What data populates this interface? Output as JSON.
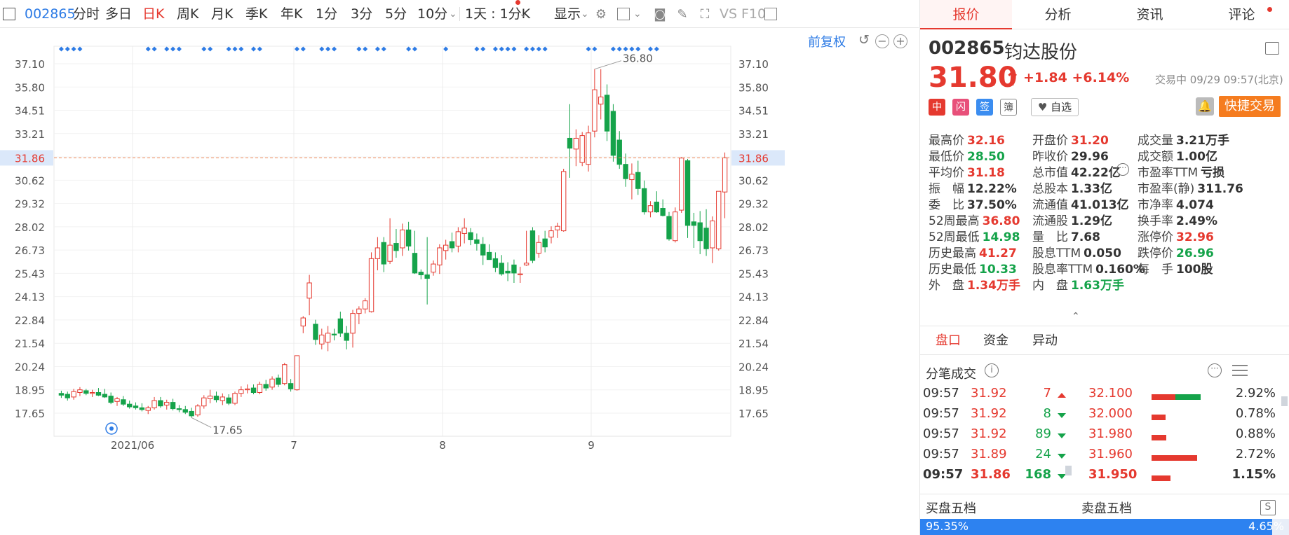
{
  "toolbar": {
    "code": "002865",
    "periods": [
      "分时",
      "多日",
      "日K",
      "周K",
      "月K",
      "季K",
      "年K",
      "1分",
      "3分",
      "5分",
      "10分"
    ],
    "active_period": "日K",
    "range_select": "1天 : 1分K",
    "display_label": "显示",
    "vs_label": "VS",
    "f10_label": "F10"
  },
  "chart": {
    "adjust_label": "前复权",
    "current_line_label": "31.86",
    "high_marker": "36.80",
    "low_marker": "17.65",
    "x_tick_labels": [
      "2021/06",
      "7",
      "8",
      "9"
    ]
  },
  "tabs": [
    "报价",
    "分析",
    "资讯",
    "评论"
  ],
  "quote": {
    "code": "002865",
    "name": "钧达股份",
    "price": "31.80",
    "change": "+1.84",
    "change_pct": "+6.14%",
    "status": "交易中 09/29 09:57(北京)",
    "watchlist_label": "自选",
    "quick_trade_label": "快捷交易",
    "badges": [
      "中",
      "闪",
      "签",
      "簿"
    ]
  },
  "quote_items": [
    {
      "label": "最高价",
      "value": "32.16",
      "color": "red"
    },
    {
      "label": "开盘价",
      "value": "31.20",
      "color": "red"
    },
    {
      "label": "成交量",
      "value": "3.21万手",
      "color": "dark"
    },
    {
      "label": "最低价",
      "value": "28.50",
      "color": "green"
    },
    {
      "label": "昨收价",
      "value": "29.96",
      "color": "dark"
    },
    {
      "label": "成交额",
      "value": "1.00亿",
      "color": "dark"
    },
    {
      "label": "平均价",
      "value": "31.18",
      "color": "red"
    },
    {
      "label": "总市值",
      "value": "42.22亿",
      "color": "dark"
    },
    {
      "label": "市盈率TTM",
      "value": "亏损",
      "color": "dark"
    },
    {
      "label": "振　幅",
      "value": "12.22%",
      "color": "dark"
    },
    {
      "label": "总股本",
      "value": "1.33亿",
      "color": "dark"
    },
    {
      "label": "市盈率(静)",
      "value": "311.76",
      "color": "dark"
    },
    {
      "label": "委　比",
      "value": "37.50%",
      "color": "dark"
    },
    {
      "label": "流通值",
      "value": "41.013亿",
      "color": "dark"
    },
    {
      "label": "市净率",
      "value": "4.074",
      "color": "dark"
    },
    {
      "label": "52周最高",
      "value": "36.80",
      "color": "red"
    },
    {
      "label": "流通股",
      "value": "1.29亿",
      "color": "dark"
    },
    {
      "label": "换手率",
      "value": "2.49%",
      "color": "dark"
    },
    {
      "label": "52周最低",
      "value": "14.98",
      "color": "green"
    },
    {
      "label": "量　比",
      "value": "7.68",
      "color": "dark"
    },
    {
      "label": "涨停价",
      "value": "32.96",
      "color": "red"
    },
    {
      "label": "历史最高",
      "value": "41.27",
      "color": "red"
    },
    {
      "label": "股息TTM",
      "value": "0.050",
      "color": "dark"
    },
    {
      "label": "跌停价",
      "value": "26.96",
      "color": "green"
    },
    {
      "label": "历史最低",
      "value": "10.33",
      "color": "green"
    },
    {
      "label": "股息率TTM",
      "value": "0.160%",
      "color": "dark"
    },
    {
      "label": "每　手",
      "value": "100股",
      "color": "dark"
    },
    {
      "label": "外　盘",
      "value": "1.34万手",
      "color": "red"
    },
    {
      "label": "内　盘",
      "value": "1.63万手",
      "color": "green"
    }
  ],
  "sub_tabs": [
    "盘口",
    "资金",
    "异动"
  ],
  "ticks_title": "分笔成交",
  "ticks": [
    {
      "time": "09:57",
      "price": "31.92",
      "vol": "7",
      "dir": "up"
    },
    {
      "time": "09:57",
      "price": "31.92",
      "vol": "8",
      "dir": "down"
    },
    {
      "time": "09:57",
      "price": "31.92",
      "vol": "89",
      "dir": "down"
    },
    {
      "time": "09:57",
      "price": "31.89",
      "vol": "24",
      "dir": "down"
    },
    {
      "time": "09:57",
      "price": "31.86",
      "vol": "168",
      "dir": "down"
    }
  ],
  "price_dist": [
    {
      "price": "32.100",
      "pct": "2.92%",
      "red": 0.48,
      "green": 0.52
    },
    {
      "price": "32.000",
      "pct": "0.78%",
      "red": 0.28,
      "green": 0
    },
    {
      "price": "31.980",
      "pct": "0.88%",
      "red": 0.3,
      "green": 0
    },
    {
      "price": "31.960",
      "pct": "2.72%",
      "red": 0.93,
      "green": 0
    },
    {
      "price": "31.950",
      "pct": "1.15%",
      "red": 0.39,
      "green": 0
    }
  ],
  "five_levels": {
    "buy_label": "买盘五档",
    "sell_label": "卖盘五档",
    "buy_pct": "95.35%",
    "sell_pct": "4.65%",
    "buy_ratio": 0.9535
  },
  "chart_data": {
    "type": "candlestick",
    "y_ticks": [
      "37.10",
      "35.80",
      "34.51",
      "33.21",
      "31.86",
      "30.62",
      "29.32",
      "28.02",
      "26.73",
      "25.43",
      "24.13",
      "22.84",
      "21.54",
      "20.24",
      "18.95",
      "17.65"
    ],
    "ylim": [
      16.6,
      37.9
    ],
    "current_price": 31.86,
    "x_labels": [
      "2021/06",
      "7",
      "8",
      "9"
    ],
    "candles": [
      {
        "o": 18.75,
        "h": 18.9,
        "l": 18.5,
        "c": 18.65
      },
      {
        "o": 18.7,
        "h": 18.85,
        "l": 18.35,
        "c": 18.5
      },
      {
        "o": 18.55,
        "h": 19.0,
        "l": 18.4,
        "c": 18.85
      },
      {
        "o": 18.8,
        "h": 19.1,
        "l": 18.6,
        "c": 18.95
      },
      {
        "o": 18.9,
        "h": 19.0,
        "l": 18.65,
        "c": 18.75
      },
      {
        "o": 18.75,
        "h": 18.95,
        "l": 18.55,
        "c": 18.8
      },
      {
        "o": 18.8,
        "h": 19.05,
        "l": 18.6,
        "c": 18.65
      },
      {
        "o": 18.7,
        "h": 19.0,
        "l": 18.5,
        "c": 18.55
      },
      {
        "o": 18.6,
        "h": 18.8,
        "l": 18.15,
        "c": 18.25
      },
      {
        "o": 18.3,
        "h": 18.55,
        "l": 18.05,
        "c": 18.45
      },
      {
        "o": 18.4,
        "h": 18.6,
        "l": 18.05,
        "c": 18.15
      },
      {
        "o": 18.15,
        "h": 18.35,
        "l": 17.9,
        "c": 18.0
      },
      {
        "o": 18.05,
        "h": 18.25,
        "l": 17.85,
        "c": 17.95
      },
      {
        "o": 17.95,
        "h": 18.2,
        "l": 17.75,
        "c": 17.85
      },
      {
        "o": 17.8,
        "h": 18.05,
        "l": 17.6,
        "c": 17.95
      },
      {
        "o": 17.95,
        "h": 18.55,
        "l": 17.85,
        "c": 18.35
      },
      {
        "o": 18.35,
        "h": 18.55,
        "l": 17.95,
        "c": 18.05
      },
      {
        "o": 18.1,
        "h": 18.4,
        "l": 17.85,
        "c": 18.25
      },
      {
        "o": 18.25,
        "h": 18.45,
        "l": 17.8,
        "c": 17.9
      },
      {
        "o": 17.9,
        "h": 18.1,
        "l": 17.7,
        "c": 17.85
      },
      {
        "o": 17.85,
        "h": 18.05,
        "l": 17.6,
        "c": 17.7
      },
      {
        "o": 17.75,
        "h": 17.95,
        "l": 17.4,
        "c": 17.5
      },
      {
        "o": 17.55,
        "h": 18.15,
        "l": 17.45,
        "c": 18.05
      },
      {
        "o": 18.05,
        "h": 18.65,
        "l": 17.9,
        "c": 18.5
      },
      {
        "o": 18.45,
        "h": 18.95,
        "l": 18.2,
        "c": 18.6
      },
      {
        "o": 18.6,
        "h": 18.85,
        "l": 18.25,
        "c": 18.4
      },
      {
        "o": 18.35,
        "h": 18.75,
        "l": 18.1,
        "c": 18.55
      },
      {
        "o": 18.5,
        "h": 18.7,
        "l": 18.1,
        "c": 18.2
      },
      {
        "o": 18.2,
        "h": 18.85,
        "l": 18.1,
        "c": 18.75
      },
      {
        "o": 18.75,
        "h": 19.15,
        "l": 18.55,
        "c": 18.95
      },
      {
        "o": 18.95,
        "h": 19.25,
        "l": 18.75,
        "c": 19.0
      },
      {
        "o": 19.05,
        "h": 19.25,
        "l": 18.7,
        "c": 18.8
      },
      {
        "o": 18.8,
        "h": 19.4,
        "l": 18.7,
        "c": 19.25
      },
      {
        "o": 19.25,
        "h": 19.5,
        "l": 18.9,
        "c": 19.05
      },
      {
        "o": 19.1,
        "h": 19.7,
        "l": 18.95,
        "c": 19.55
      },
      {
        "o": 19.6,
        "h": 19.8,
        "l": 19.1,
        "c": 19.25
      },
      {
        "o": 19.3,
        "h": 20.45,
        "l": 19.2,
        "c": 20.35
      },
      {
        "o": 19.3,
        "h": 19.55,
        "l": 18.85,
        "c": 19.0
      },
      {
        "o": 18.95,
        "h": 20.85,
        "l": 18.9,
        "c": 20.85
      },
      {
        "o": 22.5,
        "h": 23.05,
        "l": 22.1,
        "c": 22.95
      },
      {
        "o": 24.05,
        "h": 25.35,
        "l": 23.1,
        "c": 24.9
      },
      {
        "o": 22.6,
        "h": 22.85,
        "l": 21.45,
        "c": 21.75
      },
      {
        "o": 21.5,
        "h": 22.35,
        "l": 21.2,
        "c": 22.0
      },
      {
        "o": 21.6,
        "h": 22.5,
        "l": 21.1,
        "c": 22.1
      },
      {
        "o": 22.05,
        "h": 22.35,
        "l": 21.7,
        "c": 22.0
      },
      {
        "o": 22.9,
        "h": 23.3,
        "l": 21.9,
        "c": 22.1
      },
      {
        "o": 22.1,
        "h": 22.5,
        "l": 21.2,
        "c": 21.7
      },
      {
        "o": 22.1,
        "h": 23.4,
        "l": 21.3,
        "c": 23.2
      },
      {
        "o": 23.2,
        "h": 23.6,
        "l": 22.6,
        "c": 23.45
      },
      {
        "o": 23.45,
        "h": 24.05,
        "l": 23.2,
        "c": 23.9
      },
      {
        "o": 23.3,
        "h": 26.6,
        "l": 23.25,
        "c": 26.25
      },
      {
        "o": 26.25,
        "h": 27.45,
        "l": 25.6,
        "c": 26.85
      },
      {
        "o": 27.15,
        "h": 27.45,
        "l": 25.5,
        "c": 25.95
      },
      {
        "o": 26.1,
        "h": 28.5,
        "l": 25.95,
        "c": 27.0
      },
      {
        "o": 27.1,
        "h": 27.9,
        "l": 26.3,
        "c": 26.7
      },
      {
        "o": 26.85,
        "h": 28.2,
        "l": 26.4,
        "c": 27.85
      },
      {
        "o": 27.85,
        "h": 28.3,
        "l": 26.7,
        "c": 26.95
      },
      {
        "o": 26.55,
        "h": 27.8,
        "l": 25.4,
        "c": 25.45
      },
      {
        "o": 25.5,
        "h": 25.65,
        "l": 25.1,
        "c": 25.35
      },
      {
        "o": 25.35,
        "h": 27.45,
        "l": 23.7,
        "c": 25.15
      },
      {
        "o": 25.5,
        "h": 26.15,
        "l": 25.3,
        "c": 25.95
      },
      {
        "o": 25.9,
        "h": 27.05,
        "l": 25.4,
        "c": 26.85
      },
      {
        "o": 26.7,
        "h": 27.3,
        "l": 26.2,
        "c": 27.0
      },
      {
        "o": 27.2,
        "h": 27.7,
        "l": 26.6,
        "c": 26.85
      },
      {
        "o": 26.95,
        "h": 28.0,
        "l": 26.6,
        "c": 27.75
      },
      {
        "o": 27.65,
        "h": 28.5,
        "l": 27.1,
        "c": 27.95
      },
      {
        "o": 27.7,
        "h": 27.95,
        "l": 27.0,
        "c": 27.3
      },
      {
        "o": 27.3,
        "h": 27.65,
        "l": 26.7,
        "c": 27.1
      },
      {
        "o": 27.05,
        "h": 27.45,
        "l": 25.9,
        "c": 26.45
      },
      {
        "o": 26.6,
        "h": 27.05,
        "l": 26.2,
        "c": 26.2
      },
      {
        "o": 26.25,
        "h": 26.6,
        "l": 25.5,
        "c": 25.75
      },
      {
        "o": 26.0,
        "h": 26.45,
        "l": 25.3,
        "c": 25.4
      },
      {
        "o": 25.55,
        "h": 26.05,
        "l": 25.0,
        "c": 25.45
      },
      {
        "o": 25.9,
        "h": 26.2,
        "l": 24.9,
        "c": 25.45
      },
      {
        "o": 25.35,
        "h": 25.8,
        "l": 24.9,
        "c": 25.4
      },
      {
        "o": 25.9,
        "h": 27.8,
        "l": 25.85,
        "c": 26.0
      },
      {
        "o": 27.8,
        "h": 28.0,
        "l": 26.0,
        "c": 26.15
      },
      {
        "o": 26.55,
        "h": 27.55,
        "l": 26.3,
        "c": 27.15
      },
      {
        "o": 27.35,
        "h": 27.8,
        "l": 26.6,
        "c": 26.9
      },
      {
        "o": 27.45,
        "h": 28.05,
        "l": 27.1,
        "c": 27.8
      },
      {
        "o": 27.85,
        "h": 28.25,
        "l": 27.4,
        "c": 28.05
      },
      {
        "o": 27.8,
        "h": 31.25,
        "l": 27.75,
        "c": 31.1
      },
      {
        "o": 32.95,
        "h": 34.85,
        "l": 30.75,
        "c": 32.4
      },
      {
        "o": 32.35,
        "h": 33.45,
        "l": 31.4,
        "c": 32.95
      },
      {
        "o": 31.6,
        "h": 33.3,
        "l": 31.4,
        "c": 33.1
      },
      {
        "o": 31.5,
        "h": 33.65,
        "l": 31.1,
        "c": 33.25
      },
      {
        "o": 33.35,
        "h": 36.8,
        "l": 33.0,
        "c": 35.65
      },
      {
        "o": 34.85,
        "h": 36.8,
        "l": 34.0,
        "c": 35.25
      },
      {
        "o": 35.35,
        "h": 35.95,
        "l": 32.8,
        "c": 33.35
      },
      {
        "o": 34.45,
        "h": 34.85,
        "l": 31.65,
        "c": 32.0
      },
      {
        "o": 32.85,
        "h": 33.35,
        "l": 31.25,
        "c": 31.5
      },
      {
        "o": 31.5,
        "h": 32.1,
        "l": 30.25,
        "c": 30.7
      },
      {
        "o": 30.65,
        "h": 31.55,
        "l": 29.55,
        "c": 30.95
      },
      {
        "o": 31.05,
        "h": 31.7,
        "l": 29.8,
        "c": 30.15
      },
      {
        "o": 30.15,
        "h": 30.6,
        "l": 28.7,
        "c": 28.85
      },
      {
        "o": 28.85,
        "h": 29.45,
        "l": 28.55,
        "c": 29.2
      },
      {
        "o": 29.4,
        "h": 30.0,
        "l": 28.8,
        "c": 28.85
      },
      {
        "o": 29.05,
        "h": 29.55,
        "l": 28.6,
        "c": 28.65
      },
      {
        "o": 28.6,
        "h": 28.85,
        "l": 27.25,
        "c": 27.35
      },
      {
        "o": 27.25,
        "h": 29.1,
        "l": 27.15,
        "c": 28.85
      },
      {
        "o": 28.95,
        "h": 31.9,
        "l": 28.8,
        "c": 31.85
      },
      {
        "o": 31.7,
        "h": 31.8,
        "l": 27.4,
        "c": 28.1
      },
      {
        "o": 28.3,
        "h": 28.8,
        "l": 26.85,
        "c": 28.1
      },
      {
        "o": 28.25,
        "h": 28.9,
        "l": 26.5,
        "c": 27.25
      },
      {
        "o": 27.95,
        "h": 29.0,
        "l": 26.4,
        "c": 26.8
      },
      {
        "o": 26.85,
        "h": 28.6,
        "l": 26.0,
        "c": 28.35
      },
      {
        "o": 26.8,
        "h": 30.0,
        "l": 26.7,
        "c": 30.0
      },
      {
        "o": 29.96,
        "h": 32.16,
        "l": 28.5,
        "c": 31.86
      }
    ],
    "event_markers": [
      0,
      1,
      2,
      3,
      14,
      15,
      17,
      18,
      19,
      23,
      24,
      27,
      28,
      29,
      31,
      32,
      38,
      39,
      42,
      43,
      44,
      48,
      49,
      51,
      52,
      56,
      57,
      62,
      67,
      68,
      70,
      71,
      72,
      73,
      75,
      76,
      77,
      78,
      85,
      86,
      89,
      90,
      91,
      92,
      93,
      95,
      96
    ]
  }
}
